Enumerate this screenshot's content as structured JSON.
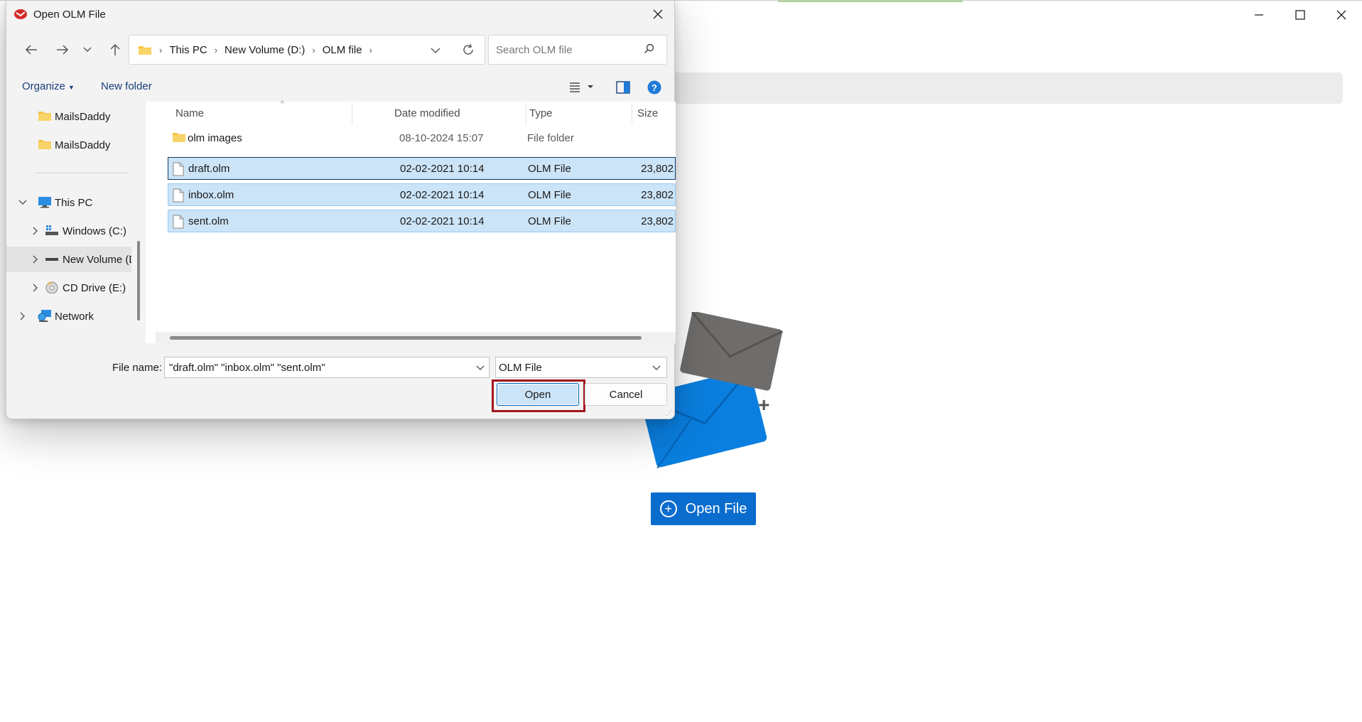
{
  "dialog": {
    "title": "Open OLM File",
    "breadcrumb": [
      "This PC",
      "New Volume (D:)",
      "OLM file"
    ],
    "search_placeholder": "Search OLM file",
    "toolbar": {
      "organize": "Organize",
      "new_folder": "New folder"
    },
    "nav_items": [
      {
        "label": "MailsDaddy",
        "icon": "folder-icon"
      },
      {
        "label": "MailsDaddy",
        "icon": "folder-icon"
      },
      {
        "label": "This PC",
        "icon": "computer-icon"
      },
      {
        "label": "Windows (C:)",
        "icon": "drive-icon"
      },
      {
        "label": "New Volume (D:)",
        "icon": "drive-icon"
      },
      {
        "label": "CD Drive (E:)",
        "icon": "cd-drive-icon"
      },
      {
        "label": "Network",
        "icon": "network-icon"
      }
    ],
    "columns": {
      "name": "Name",
      "date": "Date modified",
      "type": "Type",
      "size": "Size"
    },
    "files": [
      {
        "name": "olm images",
        "date": "08-10-2024 15:07",
        "type": "File folder",
        "size": "",
        "icon": "folder-icon",
        "selected": false
      },
      {
        "name": "draft.olm",
        "date": "02-02-2021 10:14",
        "type": "OLM File",
        "size": "23,802",
        "icon": "file-icon",
        "selected": true
      },
      {
        "name": "inbox.olm",
        "date": "02-02-2021 10:14",
        "type": "OLM File",
        "size": "23,802",
        "icon": "file-icon",
        "selected": true
      },
      {
        "name": "sent.olm",
        "date": "02-02-2021 10:14",
        "type": "OLM File",
        "size": "23,802",
        "icon": "file-icon",
        "selected": true
      }
    ],
    "file_name_label": "File name:",
    "file_name_value": "\"draft.olm\" \"inbox.olm\" \"sent.olm\"",
    "file_type": "OLM File",
    "open_label": "Open",
    "cancel_label": "Cancel"
  },
  "app": {
    "open_file_label": "Open File",
    "accent_color": "#0a6ccd"
  }
}
